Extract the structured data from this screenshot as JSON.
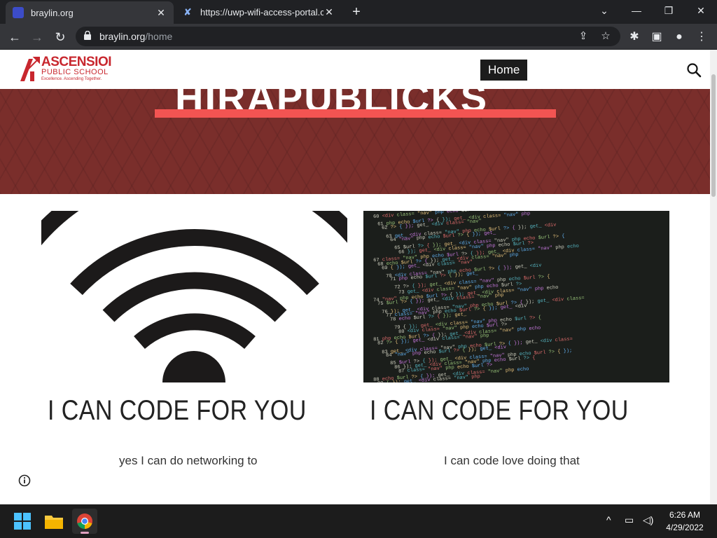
{
  "browser": {
    "tabs": [
      {
        "title": "braylin.org",
        "active": true
      },
      {
        "title": "https://uwp-wifi-access-portal.co",
        "active": false
      }
    ],
    "url_host": "braylin.org",
    "url_path": "/home"
  },
  "site": {
    "logo": {
      "brand": "ASCENSIOI",
      "sub": "PUBLIC SCHOOL",
      "tagline": "Excellence. Ascending Together."
    },
    "nav": {
      "home_label": "Home"
    },
    "hero": {
      "title": "HIRAPUBLICKS",
      "accent_color": "#f35452",
      "bg_color": "#7a2e2b"
    },
    "cards": [
      {
        "title": "I CAN CODE FOR YOU",
        "text": "yes I can do networking  to",
        "image": "wifi-icon"
      },
      {
        "title": "I CAN CODE FOR YOU",
        "text": "I can code love doing that",
        "image": "code-screenshot"
      }
    ]
  },
  "taskbar": {
    "time": "6:26 AM",
    "date": "4/29/2022"
  }
}
